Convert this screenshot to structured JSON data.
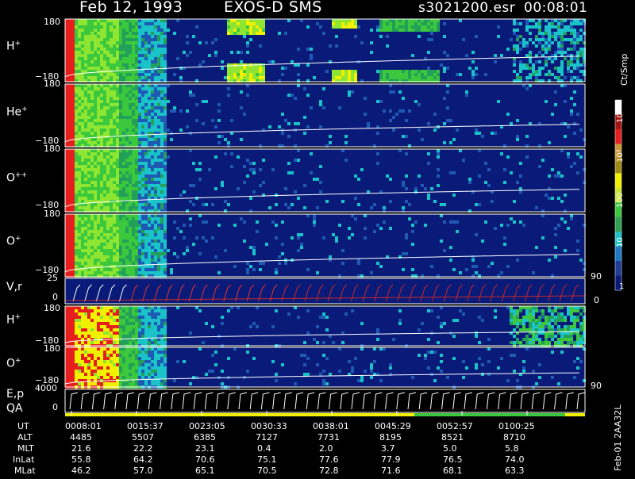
{
  "header": {
    "date": "Feb 12, 1993",
    "instrument": "EXOS-D SMS",
    "file": "s3021200.esr",
    "time": "00:08:01"
  },
  "panels": [
    {
      "label": "H+",
      "base": "H",
      "sup": "+",
      "ytop": "180",
      "ybot": "−180"
    },
    {
      "label": "He+",
      "base": "He",
      "sup": "+",
      "ytop": "180",
      "ybot": "−180"
    },
    {
      "label": "O++",
      "base": "O",
      "sup": "++",
      "ytop": "180",
      "ybot": "−180"
    },
    {
      "label": "O+",
      "base": "O",
      "sup": "+",
      "ytop": "180",
      "ybot": "−180"
    },
    {
      "label": "V,r",
      "base": "V,r",
      "sup": "",
      "ytop": "25",
      "ybot": "0",
      "right_top": "90",
      "right_bot": "0"
    },
    {
      "label": "H+",
      "base": "H",
      "sup": "+",
      "ytop": "180",
      "ybot": "−180"
    },
    {
      "label": "O+",
      "base": "O",
      "sup": "+",
      "ytop": "180",
      "ybot": "−180",
      "right_bot": "90"
    },
    {
      "label": "E,p",
      "base": "E,p",
      "sup": "",
      "ytop": "4000",
      "ybot": "0",
      "extra": "QA"
    }
  ],
  "colorbar": {
    "title": "Ct/Smp",
    "ticks": [
      "10⁴",
      "10³",
      "100",
      "10",
      "1"
    ]
  },
  "side_note": "Feb-01 2AA32L",
  "table": {
    "row_labels": [
      "UT",
      "ALT",
      "MLT",
      "InLat",
      "MLat"
    ],
    "columns": [
      [
        "0008:01",
        "4485",
        "21.6",
        "55.8",
        "46.2"
      ],
      [
        "0015:37",
        "5507",
        "22.2",
        "64.2",
        "57.0"
      ],
      [
        "0023:05",
        "6385",
        "23.1",
        "70.6",
        "65.1"
      ],
      [
        "0030:33",
        "7127",
        "0.4",
        "75.1",
        "70.5"
      ],
      [
        "0038:01",
        "7731",
        "2.0",
        "77.6",
        "72.8"
      ],
      [
        "0045:29",
        "8195",
        "3.7",
        "77.9",
        "71.6"
      ],
      [
        "0052:57",
        "8521",
        "5.0",
        "76.5",
        "68.1"
      ],
      [
        "0100:25",
        "8710",
        "5.8",
        "74.0",
        "63.3"
      ]
    ]
  },
  "chart_data": {
    "type": "heatmap",
    "title": "Feb 12, 1993   EXOS-D SMS",
    "x_ticks": [
      "0008:01",
      "0015:37",
      "0023:05",
      "0030:33",
      "0038:01",
      "0045:29",
      "0052:57",
      "0100:25"
    ],
    "ylim_pitch": [
      -180,
      180
    ],
    "ylim_velocity": [
      0,
      25
    ],
    "ylim_energy": [
      0,
      4000
    ],
    "color_scale": "log",
    "color_range": [
      1,
      10000
    ],
    "colors": {
      "background": "#000000",
      "low": "#0a1a78",
      "cyan": "#19c3c8",
      "green": "#3cc83c",
      "yellow": "#f0f000",
      "red": "#e61e1e",
      "white": "#ffffff"
    }
  }
}
